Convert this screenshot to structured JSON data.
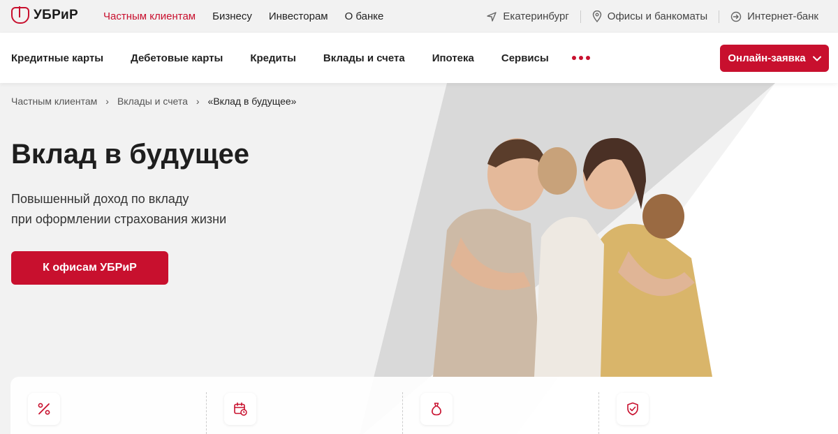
{
  "brand": {
    "name": "УБРиР",
    "accent": "#c8102e"
  },
  "topnav": {
    "items": [
      "Частным клиентам",
      "Бизнесу",
      "Инвесторам",
      "О банке"
    ],
    "active_index": 0
  },
  "topright": {
    "city": "Екатеринбург",
    "offices": "Офисы и банкоматы",
    "ibank": "Интернет-банк"
  },
  "mainnav": {
    "items": [
      "Кредитные карты",
      "Дебетовые карты",
      "Кредиты",
      "Вклады и счета",
      "Ипотека",
      "Сервисы"
    ],
    "more_icon": "more-dots-icon",
    "apply_label": "Онлайн-заявка"
  },
  "breadcrumb": [
    "Частным клиентам",
    "Вклады и счета",
    "«Вклад в будущее»"
  ],
  "hero": {
    "title": "Вклад в будущее",
    "subtitle_line1": "Повышенный доход по вкладу",
    "subtitle_line2": "при оформлении страхования жизни",
    "button_label": "К офисам УБРиР"
  },
  "features": [
    {
      "icon": "percent-icon"
    },
    {
      "icon": "calendar-clock-icon"
    },
    {
      "icon": "money-bag-icon"
    },
    {
      "icon": "shield-check-icon"
    }
  ]
}
